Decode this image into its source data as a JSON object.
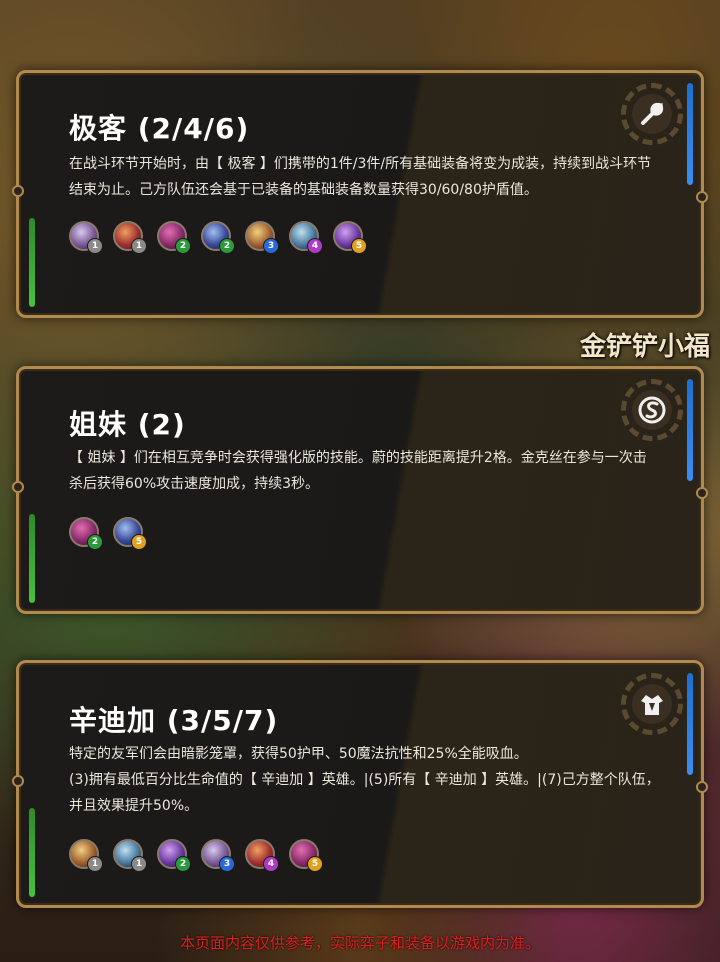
{
  "watermark": "金铲铲小福",
  "footer_note": "本页面内容仅供参考，实际弈子和装备以游戏内为准。",
  "colors": {
    "cost1": "#8a8a8a",
    "cost2": "#2a9a3a",
    "cost3": "#2a6ad8",
    "cost4": "#b03ac8",
    "cost5": "#e0a020",
    "frame": "#b08a4e"
  },
  "traits": [
    {
      "title": "极客 (2/4/6)",
      "icon": "wrench-icon",
      "description_lines": [
        "在战斗环节开始时，由【 极客 】们携带的1件/3件/所有基础装备将变为成装，持续到战斗环节",
        "结束为止。己方队伍还会基于已装备的基础装备数量获得30/60/80护盾值。"
      ],
      "champions": [
        {
          "cost": "1"
        },
        {
          "cost": "1"
        },
        {
          "cost": "2"
        },
        {
          "cost": "2"
        },
        {
          "cost": "3"
        },
        {
          "cost": "4"
        },
        {
          "cost": "5"
        }
      ]
    },
    {
      "title": "姐妹 (2)",
      "icon": "sisters-icon",
      "description_lines": [
        "【 姐妹 】们在相互竞争时会获得强化版的技能。蔚的技能距离提升2格。金克丝在参与一次击",
        "杀后获得60%攻击速度加成，持续3秒。"
      ],
      "champions": [
        {
          "cost": "2"
        },
        {
          "cost": "5"
        }
      ]
    },
    {
      "title": "辛迪加 (3/5/7)",
      "icon": "cloak-icon",
      "description_lines": [
        "特定的友军们会由暗影笼罩，获得50护甲、50魔法抗性和25%全能吸血。",
        "(3)拥有最低百分比生命值的【 辛迪加 】英雄。|(5)所有【 辛迪加 】英雄。|(7)己方整个队伍，",
        "并且效果提升50%。"
      ],
      "champions": [
        {
          "cost": "1"
        },
        {
          "cost": "1"
        },
        {
          "cost": "2"
        },
        {
          "cost": "3"
        },
        {
          "cost": "4"
        },
        {
          "cost": "5"
        }
      ]
    }
  ]
}
